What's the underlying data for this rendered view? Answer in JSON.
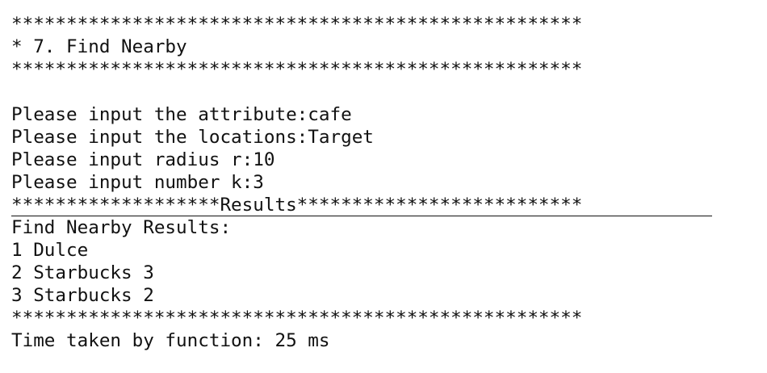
{
  "terminal": {
    "header_top_border": "****************************************************",
    "header_title": "* 7. Find Nearby",
    "header_bottom_border": "****************************************************",
    "prompts": [
      {
        "label": "Please input the attribute:",
        "value": "cafe"
      },
      {
        "label": "Please input the locations:",
        "value": "Target"
      },
      {
        "label": "Please input radius r:",
        "value": "10"
      },
      {
        "label": "Please input number k:",
        "value": "3"
      }
    ],
    "results_divider": "*******************Results**************************",
    "results_heading": "Find Nearby Results:",
    "results": [
      "1 Dulce",
      "2 Starbucks 3",
      "3 Starbucks 2"
    ],
    "footer_border": "****************************************************",
    "timing": "Time taken by function: 25 ms"
  }
}
